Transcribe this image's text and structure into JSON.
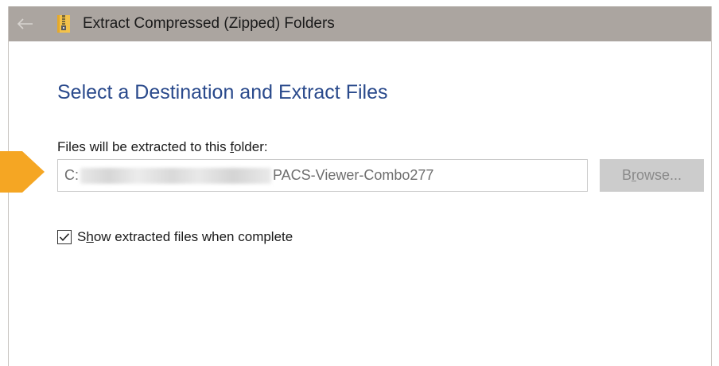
{
  "window": {
    "title": "Extract Compressed (Zipped) Folders"
  },
  "main": {
    "heading": "Select a Destination and Extract Files",
    "field_label_before": "Files will be extracted to this ",
    "field_label_accel": "f",
    "field_label_after": "older:",
    "path": {
      "drive": "C:",
      "folder": "PACS-Viewer-Combo277"
    },
    "browse_before": "B",
    "browse_accel": "r",
    "browse_after": "owse...",
    "show_files": {
      "checked": true,
      "label_before": "S",
      "label_accel": "h",
      "label_after": "ow extracted files when complete"
    }
  },
  "colors": {
    "titlebar": "#aba5a0",
    "heading": "#2a4a8c",
    "annotation_arrow": "#f5a623",
    "browse_disabled": "#cccccc"
  },
  "icons": {
    "back": "back-arrow-icon",
    "zip": "zip-folder-icon",
    "check": "checkmark-icon",
    "annotation": "orange-pointer-arrow-icon"
  }
}
